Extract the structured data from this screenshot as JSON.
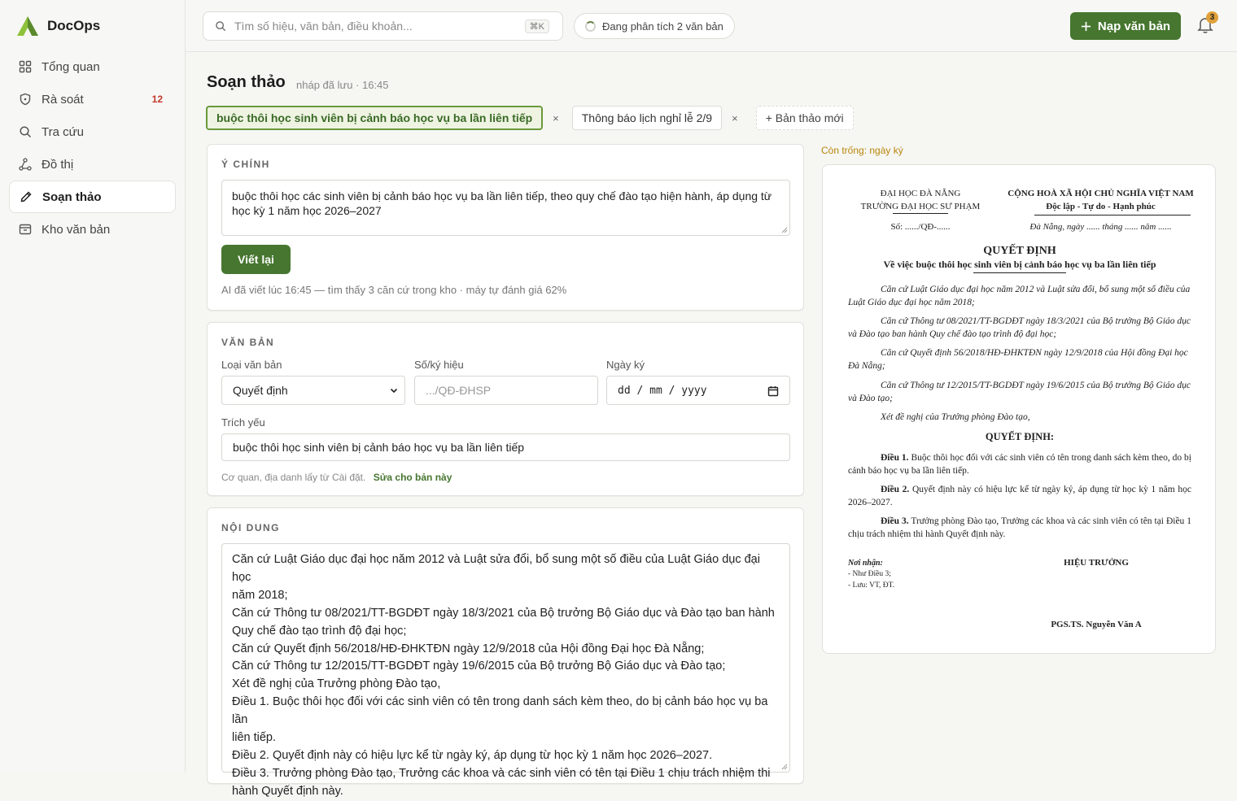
{
  "app": {
    "name": "DocOps"
  },
  "sidebar": {
    "items": [
      {
        "label": "Tổng quan",
        "icon": "grid-icon"
      },
      {
        "label": "Rà soát",
        "icon": "shield-icon",
        "badge": "12"
      },
      {
        "label": "Tra cứu",
        "icon": "search-icon"
      },
      {
        "label": "Đồ thị",
        "icon": "graph-icon"
      },
      {
        "label": "Soạn thảo",
        "icon": "pen-icon",
        "active": true
      },
      {
        "label": "Kho văn bản",
        "icon": "archive-icon"
      }
    ]
  },
  "topbar": {
    "search_placeholder": "Tìm số hiệu, văn bản, điều khoản...",
    "search_shortcut": "⌘K",
    "status": "Đang phân tích 2 văn bản",
    "upload_button": "Nạp văn bản",
    "notification_count": "3"
  },
  "page": {
    "title": "Soạn thảo",
    "subtitle": "nháp đã lưu · 16:45"
  },
  "tabs": [
    {
      "label": "buộc thôi học sinh viên bị cảnh báo học vụ ba lần liên tiếp",
      "active": true,
      "close": "×"
    },
    {
      "label": "Thông báo lịch nghỉ lễ 2/9",
      "active": false,
      "close": "×"
    }
  ],
  "new_tab_label": "+ Bản thảo mới",
  "main_idea": {
    "section_label": "Ý CHÍNH",
    "text": "buộc thôi học các sinh viên bị cảnh báo học vụ ba lần liên tiếp, theo quy chế đào tạo hiện hành, áp dụng từ học kỳ 1 năm học 2026–2027",
    "rewrite_button": "Viết lại",
    "ai_note": "AI đã viết lúc 16:45 — tìm thấy 3 căn cứ trong kho · máy tự đánh giá 62%"
  },
  "document": {
    "section_label": "VĂN BẢN",
    "type_label": "Loại văn bản",
    "type_value": "Quyết định",
    "number_label": "Số/ký hiệu",
    "number_placeholder": ".../QĐ-ĐHSP",
    "date_label": "Ngày ký",
    "date_placeholder": "dd / mm / yyyy",
    "summary_label": "Trích yếu",
    "summary_value": "buộc thôi học sinh viên bị cảnh báo học vụ ba lần liên tiếp",
    "settings_note": "Cơ quan, địa danh lấy từ Cài đặt.",
    "settings_link": "Sửa cho bản này"
  },
  "content": {
    "section_label": "NỘI DUNG",
    "lines": [
      "Căn cứ Luật Giáo dục đại học năm 2012 và Luật sửa đổi, bổ sung một số điều của Luật Giáo dục đại học",
      "năm 2018;",
      "Căn cứ Thông tư 08/2021/TT-BGDĐT ngày 18/3/2021 của Bộ trưởng Bộ Giáo dục và Đào tạo ban hành",
      "Quy chế đào tạo trình độ đại học;",
      "Căn cứ Quyết định 56/2018/HĐ-ĐHKTĐN ngày 12/9/2018 của Hội đồng Đại học Đà Nẵng;",
      "Căn cứ Thông tư 12/2015/TT-BGDĐT ngày 19/6/2015 của Bộ trưởng Bộ Giáo dục và Đào tạo;",
      "Xét đề nghị của Trưởng phòng Đào tạo,",
      "Điều 1. Buộc thôi học đối với các sinh viên có tên trong danh sách kèm theo, do bị cảnh báo học vụ ba lần",
      "liên tiếp.",
      "Điều 2. Quyết định này có hiệu lực kể từ ngày ký, áp dụng từ học kỳ 1 năm học 2026–2027.",
      "Điều 3. Trưởng phòng Đào tạo, Trưởng các khoa và các sinh viên có tên tại Điều 1 chịu trách nhiệm thi",
      "hành Quyết định này."
    ]
  },
  "preview": {
    "note": "Còn trống: ngày ký",
    "org_parent": "ĐẠI HỌC ĐÀ NẴNG",
    "org_name": "TRƯỜNG ĐẠI HỌC SƯ PHẠM",
    "number": "Số: ....../QĐ-......",
    "nation": "CỘNG HOÀ XÃ HỘI CHỦ NGHĨA VIỆT NAM",
    "motto": "Độc lập - Tự do - Hạnh phúc",
    "place_date": "Đà Nẵng, ngày ...... tháng ...... năm ......",
    "doc_type": "QUYẾT ĐỊNH",
    "doc_subject": "Về việc buộc thôi học sinh viên bị cảnh báo học vụ ba lần liên tiếp",
    "bases": [
      "Căn cứ Luật Giáo dục đại học năm 2012 và Luật sửa đổi, bổ sung một số điều của Luật Giáo dục đại học năm 2018;",
      "Căn cứ Thông tư 08/2021/TT-BGDĐT ngày 18/3/2021 của Bộ trưởng Bộ Giáo dục và Đào tạo ban hành Quy chế đào tạo trình độ đại học;",
      "Căn cứ Quyết định 56/2018/HĐ-ĐHKTĐN ngày 12/9/2018 của Hội đồng Đại học Đà Nẵng;",
      "Căn cứ Thông tư 12/2015/TT-BGDĐT ngày 19/6/2015 của Bộ trưởng Bộ Giáo dục và Đào tạo;",
      "Xét đề nghị của Trưởng phòng Đào tạo,"
    ],
    "decide_heading": "QUYẾT ĐỊNH:",
    "articles": [
      {
        "title": "Điều 1.",
        "text": "Buộc thôi học đối với các sinh viên có tên trong danh sách kèm theo, do bị cảnh báo học vụ ba lần liên tiếp."
      },
      {
        "title": "Điều 2.",
        "text": "Quyết định này có hiệu lực kể từ ngày ký, áp dụng từ học kỳ 1 năm học 2026–2027."
      },
      {
        "title": "Điều 3.",
        "text": "Trưởng phòng Đào tạo, Trưởng các khoa và các sinh viên có tên tại Điều 1 chịu trách nhiệm thi hành Quyết định này."
      }
    ],
    "recipients_title": "Nơi nhận:",
    "recipients": [
      "- Như Điều 3;",
      "- Lưu: VT, ĐT."
    ],
    "signer_title": "HIỆU TRƯỞNG",
    "signer_name": "PGS.TS. Nguyễn Văn A"
  },
  "colors": {
    "accent": "#46762f",
    "warning": "#b8860b",
    "badge": "#e0a13a"
  }
}
